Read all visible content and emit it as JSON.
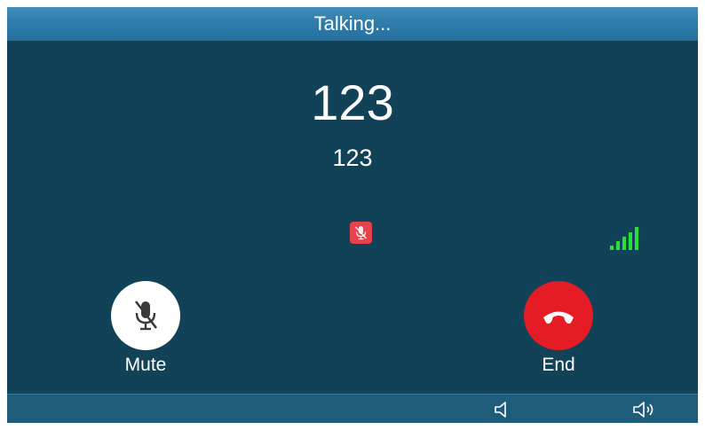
{
  "header": {
    "title": "Talking..."
  },
  "call": {
    "name": "123",
    "number": "123",
    "status_icon": "muted-microphone-icon",
    "signal_level": 5,
    "signal_max": 5,
    "signal_color": "#29e03a"
  },
  "actions": {
    "mute_label": "Mute",
    "end_label": "End"
  },
  "bottom_bar": {
    "volume_down_icon": "speaker-volume-down-icon",
    "volume_up_icon": "speaker-volume-up-icon"
  },
  "colors": {
    "background": "#124257",
    "header": "#2d7aa8",
    "end_button": "#e51c26",
    "mute_badge": "#e8424c",
    "bottom_bar": "#1f5c7a"
  }
}
